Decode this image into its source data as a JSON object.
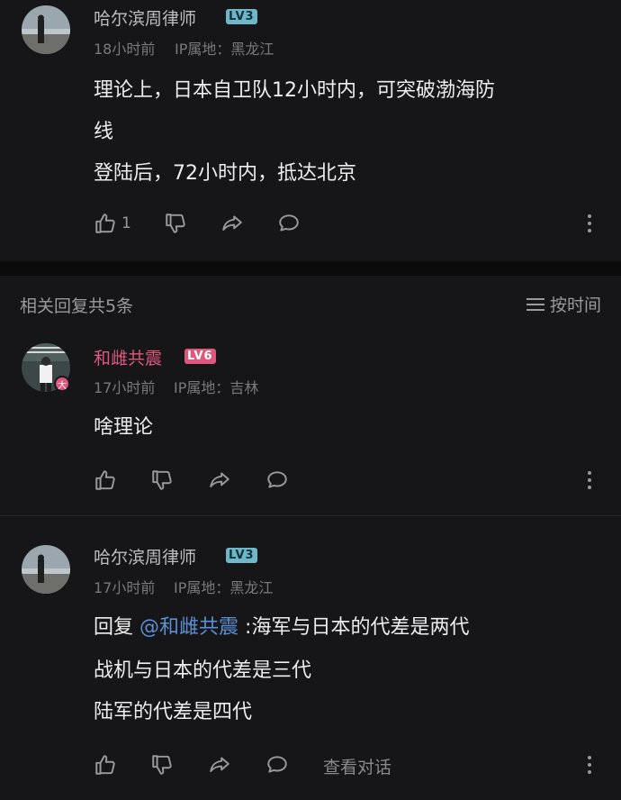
{
  "top_comment": {
    "username": "哈尔滨周律师",
    "level": "LV3",
    "time": "18小时前",
    "ip": "IP属地：黑龙江",
    "lines": [
      "理论上，日本自卫队12小时内，可突破渤海防",
      "线",
      "登陆后，72小时内，抵达北京"
    ],
    "like_count": "1"
  },
  "replies_header": {
    "title": "相关回复共5条",
    "sort_label": "按时间"
  },
  "reply1": {
    "username": "和雌共震",
    "level": "LV6",
    "time": "17小时前",
    "ip": "IP属地：吉林",
    "text": "啥理论",
    "badge": "大"
  },
  "reply2": {
    "username": "哈尔滨周律师",
    "level": "LV3",
    "time": "17小时前",
    "ip": "IP属地：黑龙江",
    "reply_prefix": "回复",
    "mention": "@和雌共震",
    "line1_rest": ":海军与日本的代差是两代",
    "line2": "战机与日本的代差是三代",
    "line3": "陆军的代差是四代",
    "view_dialog": "查看对话"
  },
  "colors": {
    "background": "#161618",
    "accent_pink": "#e0577d",
    "mention_blue": "#5b8fd6",
    "level_blue": "#6fb6c9"
  },
  "icons": [
    "thumbs-up-icon",
    "thumbs-down-icon",
    "share-icon",
    "comment-icon",
    "more-icon",
    "sort-icon"
  ]
}
